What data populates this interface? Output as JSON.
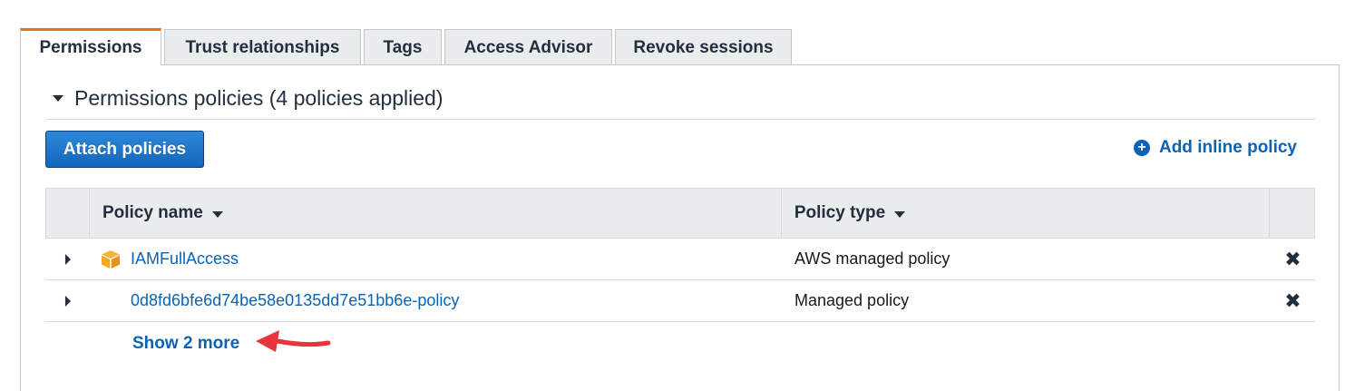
{
  "tabs": [
    {
      "label": "Permissions",
      "active": true
    },
    {
      "label": "Trust relationships",
      "active": false
    },
    {
      "label": "Tags",
      "active": false
    },
    {
      "label": "Access Advisor",
      "active": false
    },
    {
      "label": "Revoke sessions",
      "active": false
    }
  ],
  "section": {
    "title": "Permissions policies (4 policies applied)",
    "attach_button": "Attach policies",
    "add_inline_link": "Add inline policy"
  },
  "table": {
    "columns": {
      "name": "Policy name",
      "type": "Policy type"
    },
    "rows": [
      {
        "name": "IAMFullAccess",
        "type": "AWS managed policy",
        "icon": "aws-managed-cube-icon"
      },
      {
        "name": "0d8fd6bfe6d74be58e0135dd7e51bb6e-policy",
        "type": "Managed policy",
        "icon": ""
      }
    ],
    "show_more": "Show 2 more"
  },
  "colors": {
    "accent_tab": "#ec7211",
    "link": "#0a63b5",
    "button": "#1166bb",
    "annotation_arrow": "#e8343a",
    "cube": "#f5a623"
  }
}
